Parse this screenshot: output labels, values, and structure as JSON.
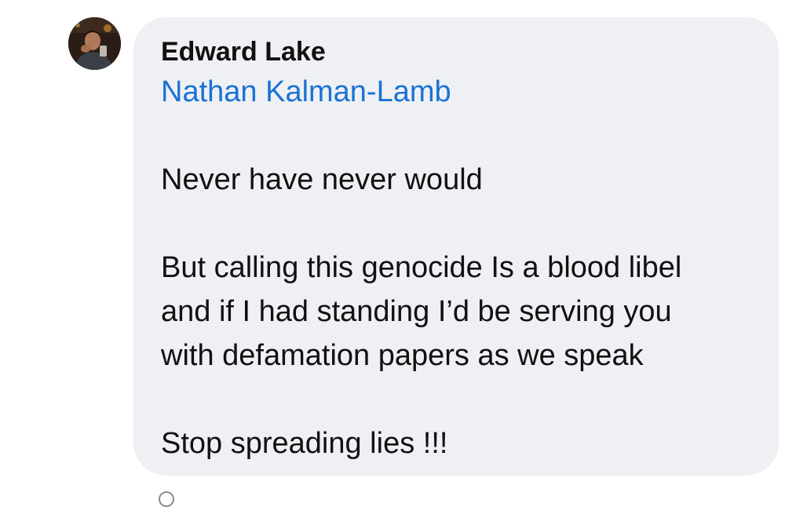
{
  "comment": {
    "author": "Edward Lake",
    "mention": "Nathan Kalman-Lamb",
    "lines": [
      "Never have never would",
      "But calling this genocide Is a blood libel",
      "and if I had standing I’d be serving you",
      "with defamation papers as we speak",
      "Stop spreading lies !!!"
    ]
  },
  "colors": {
    "bubble": "#eff0f4",
    "mention": "#1a72d4",
    "text": "#111111"
  },
  "icons": {
    "avatar": "profile-photo"
  }
}
